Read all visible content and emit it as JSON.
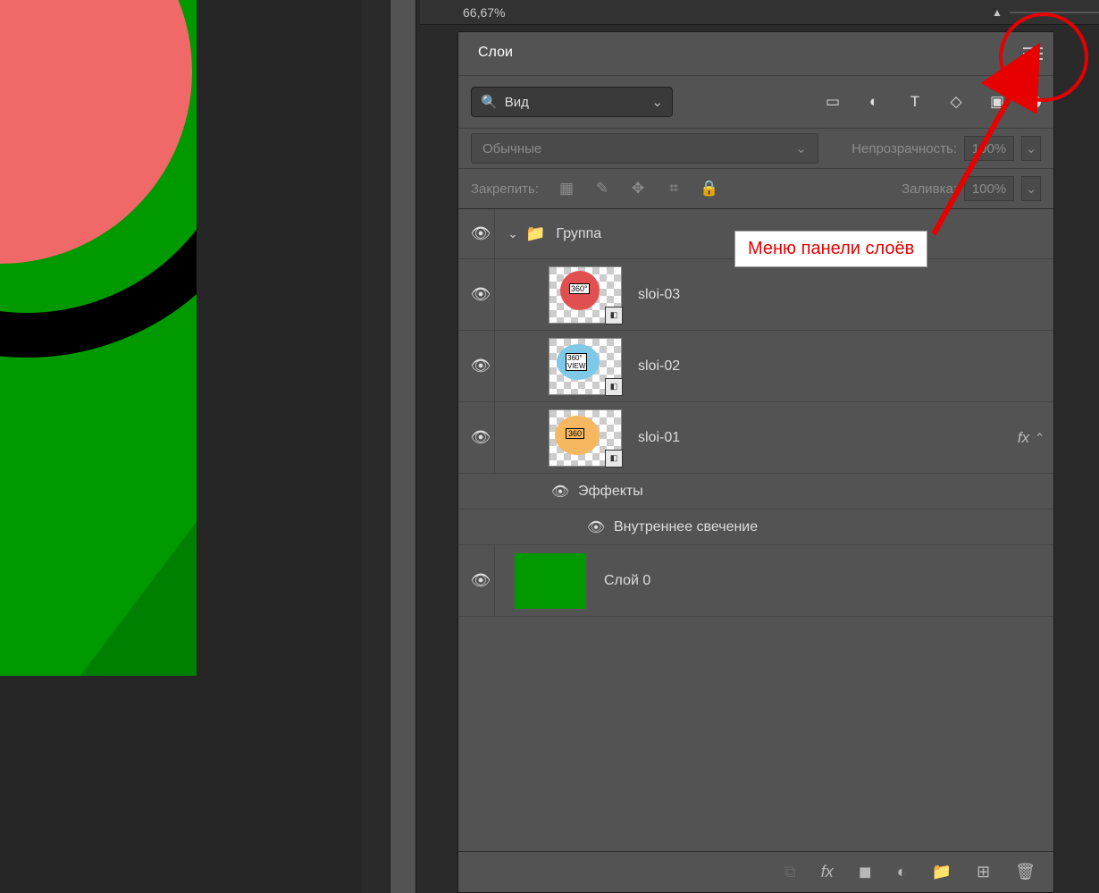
{
  "zoom": {
    "value": "66,67%",
    "small_icon": "▲",
    "big_icon": "▲"
  },
  "panel": {
    "tab_layers": "Слои",
    "search_placeholder": "Вид",
    "blend_mode": "Обычные",
    "opacity_label": "Непрозрачность:",
    "opacity_value": "100%",
    "lock_label": "Закрепить:",
    "fill_label": "Заливка:",
    "fill_value": "100%"
  },
  "layers": {
    "group_name": "Группа",
    "sloi03": "sloi-03",
    "sloi02": "sloi-02",
    "sloi01": "sloi-01",
    "effects_label": "Эффекты",
    "inner_glow": "Внутреннее свечение",
    "bg_layer": "Слой 0",
    "fx_label": "fx"
  },
  "callout": {
    "label": "Меню панели слоёв"
  },
  "icons": {
    "search": "🔍",
    "chev_down": "⌄",
    "chev_up": "⌃",
    "image": "▭",
    "adjust": "◐",
    "text": "T",
    "shape": "◇",
    "smart": "▣",
    "dot": "●",
    "lock_pixels": "▦",
    "brush": "✎",
    "move": "✥",
    "crop": "⌗",
    "lock": "🔒",
    "eye": "👁",
    "folder": "📁",
    "link": "⧉",
    "fx": "fx",
    "mask": "◼",
    "fill_adj": "◐",
    "new_grp": "📁",
    "new_layer": "⊞",
    "trash": "🗑"
  }
}
